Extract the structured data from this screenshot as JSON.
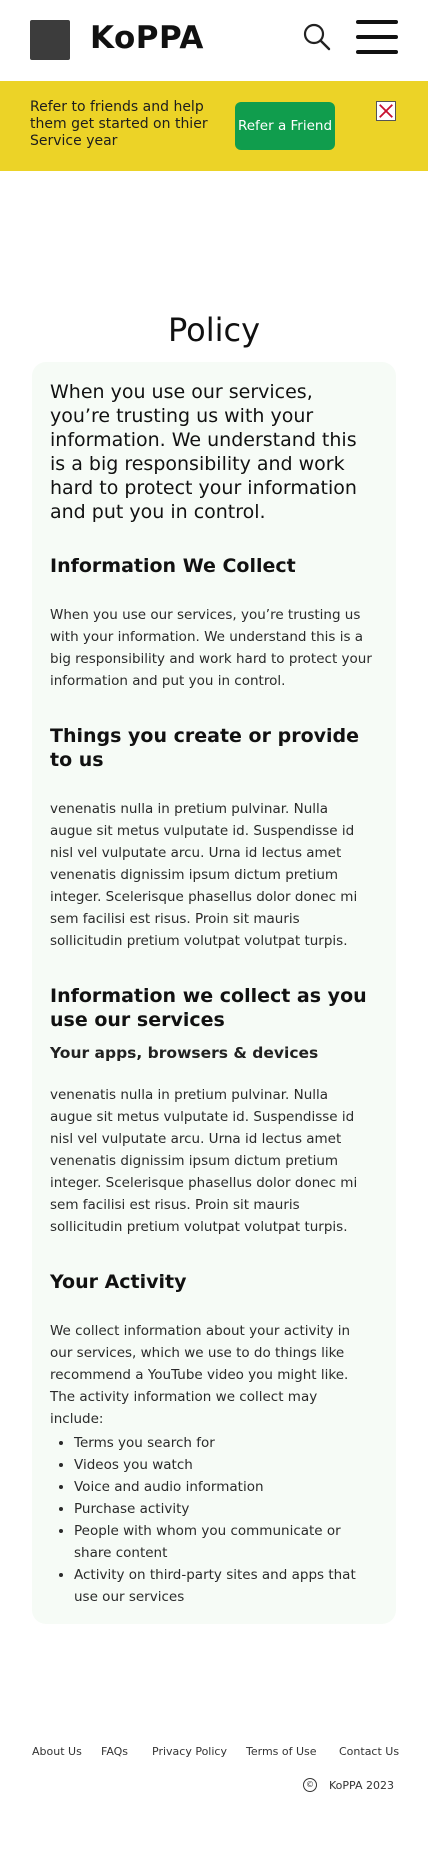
{
  "header": {
    "brand": "KoPPA",
    "icons": {
      "logo": "logo-square",
      "search": "search-icon",
      "menu": "hamburger-menu-icon"
    }
  },
  "banner": {
    "text": "Refer to friends and help them get started on thier Service year",
    "button_label": "Refer a Friend",
    "close_icon": "close-icon",
    "colors": {
      "background": "#ecd327",
      "button": "#109d4d",
      "close": "#c8102e"
    }
  },
  "page": {
    "title": "Policy"
  },
  "policy": {
    "lead": "When you use our services, you’re trusting us with your information. We understand this is a big responsibility and work hard to protect your information and put you in control.",
    "sections": [
      {
        "heading": "Information We Collect",
        "body": "When you use our services, you’re trusting us with your information. We understand this is a big responsibility and work hard to protect your information and put you in control."
      },
      {
        "heading": "Things you create or provide to us",
        "body": "venenatis nulla in pretium pulvinar. Nulla augue sit metus vulputate id. Suspendisse id nisl vel vulputate arcu. Urna id lectus amet venenatis dignissim ipsum dictum pretium integer. Scelerisque phasellus dolor donec mi sem facilisi est risus. Proin sit mauris sollicitudin pretium volutpat volutpat turpis."
      },
      {
        "heading": "Information we collect as you use our services",
        "subheading": "Your apps, browsers & devices",
        "body": "venenatis nulla in pretium pulvinar. Nulla augue sit metus vulputate id. Suspendisse id nisl vel vulputate arcu. Urna id lectus amet venenatis dignissim ipsum dictum pretium integer. Scelerisque phasellus dolor donec mi sem facilisi est risus. Proin sit mauris sollicitudin pretium volutpat volutpat turpis."
      },
      {
        "heading": "Your Activity",
        "body": "We collect information about your activity in our services, which we use to do things like recommend a YouTube video you might like. The activity information we collect may include:",
        "list": [
          "Terms you search for",
          "Videos you watch",
          "Voice and audio information",
          "Purchase activity",
          "People with whom you communicate or share content",
          "Activity on third-party sites and apps that use our services"
        ]
      }
    ]
  },
  "footer": {
    "links": [
      "About Us",
      "FAQs",
      "Privacy Policy",
      "Terms of Use",
      "Contact Us"
    ],
    "copyright": "KoPPA 2023",
    "copyright_icon": "copyright-icon"
  }
}
